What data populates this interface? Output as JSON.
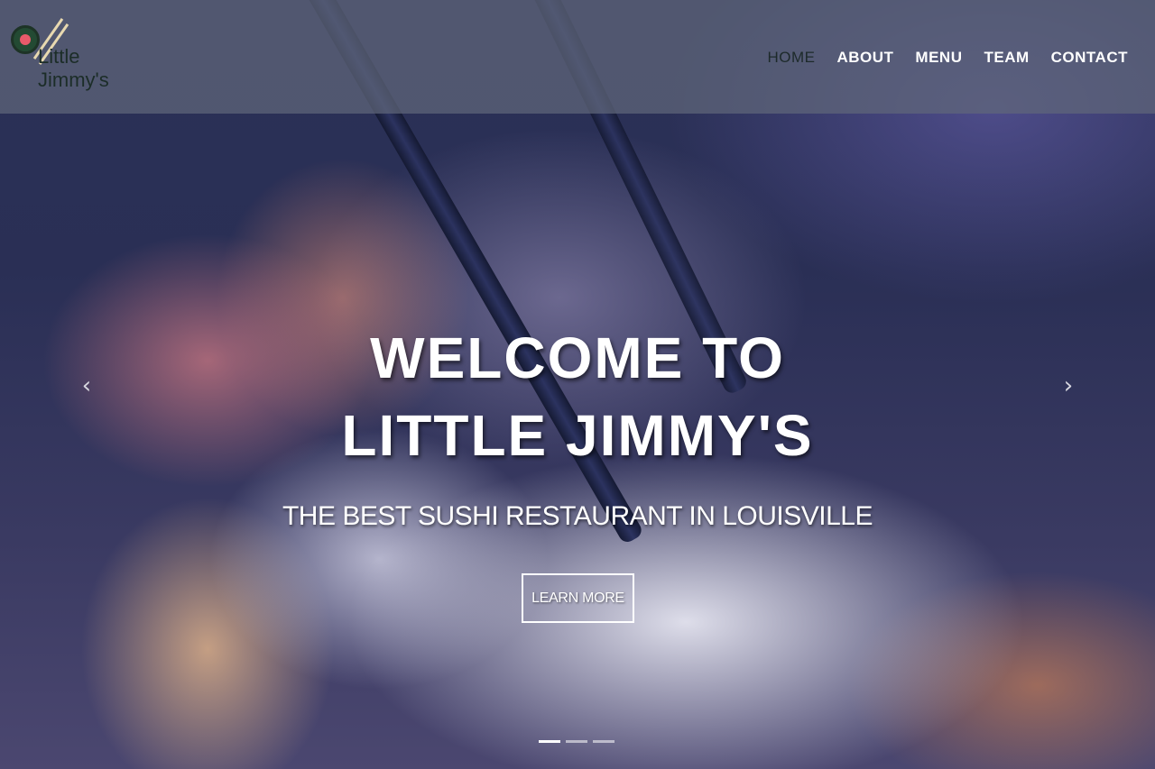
{
  "brand": {
    "logo_line1": "Little",
    "logo_line2": "Jimmy's"
  },
  "nav": {
    "items": [
      {
        "label": "HOME"
      },
      {
        "label": "ABOUT"
      },
      {
        "label": "MENU"
      },
      {
        "label": "TEAM"
      },
      {
        "label": "CONTACT"
      }
    ]
  },
  "hero": {
    "heading_line1": "WELCOME TO",
    "heading_line2": "LITTLE JIMMY'S",
    "tagline": "THE BEST SUSHI RESTAURANT IN LOUISVILLE",
    "cta_label": "LEARN MORE",
    "prev_icon": "chevron-left-icon",
    "next_icon": "chevron-right-icon",
    "prev_glyph": "‹",
    "next_glyph": "›",
    "slide_count": 3,
    "active_slide": 1
  },
  "colors": {
    "nav_active": "#1d2a2a",
    "nav_text": "#ffffff",
    "logo_green": "#234a33"
  }
}
